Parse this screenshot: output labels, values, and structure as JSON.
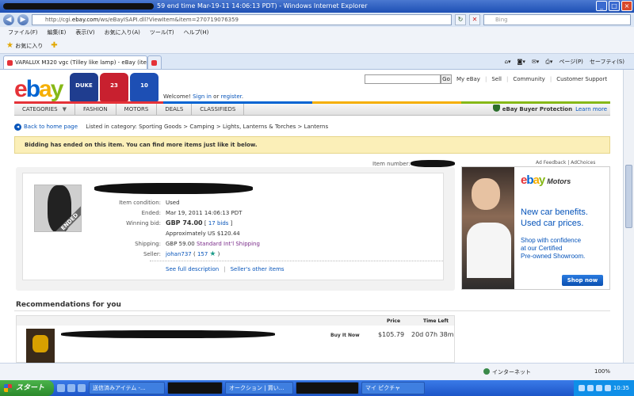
{
  "browser": {
    "title_suffix": "59 end time Mar-19-11 14:06:13 PDT) - Windows Internet Explorer",
    "url_prefix": "http://cgi.",
    "url_domain": "ebay.com",
    "url_path": "/ws/eBayISAPI.dll?ViewItem&item=270719076359",
    "search_placeholder": "Bing",
    "menu": [
      "ファイル(F)",
      "編集(E)",
      "表示(V)",
      "お気に入り(A)",
      "ツール(T)",
      "ヘルプ(H)"
    ],
    "favorites_label": "お気に入り",
    "tab_title": "VAPALUX M320 vgc (Tilley like lamp) - eBay (ite...",
    "tab_tools": [
      "ページ(P)",
      "セーフティ(S)"
    ],
    "status_zone": "インターネット",
    "zoom": "100%"
  },
  "header": {
    "welcome_prefix": "Welcome! ",
    "sign_in": "Sign in",
    "or": " or ",
    "register": "register",
    "welcome_suffix": ".",
    "go_label": "Go",
    "links": [
      "My eBay",
      "Sell",
      "Community",
      "Customer Support"
    ],
    "jerseys": [
      {
        "text": "DUKE",
        "color": "#1f3d8f"
      },
      {
        "text": "23",
        "color": "#c8202f"
      },
      {
        "text": "10",
        "color": "#1d4fb4"
      }
    ]
  },
  "nav": {
    "categories": "CATEGORIES",
    "items": [
      "FASHION",
      "MOTORS",
      "DEALS",
      "CLASSIFIEDS"
    ],
    "protection": "eBay Buyer Protection",
    "learn_more": "Learn more"
  },
  "breadcrumb": {
    "back": "Back to home page",
    "listed_in": "Listed in category:",
    "path": [
      "Sporting Goods",
      "Camping",
      "Lights, Lanterns & Torches",
      "Lanterns"
    ]
  },
  "banner": "Bidding has ended on this item. You can find more items just like it below.",
  "item": {
    "number_label": "Item number:",
    "ended_tag": "ENDED",
    "condition_label": "Item condition:",
    "condition": "Used",
    "ended_label": "Ended:",
    "ended": "Mar 19, 2011 14:06:13 PDT",
    "winning_label": "Winning bid:",
    "winning_bid": "GBP 74.00",
    "bids_open": "[ ",
    "bids": "17 bids",
    "bids_close": " ]",
    "approx": "Approximately US $120.44",
    "shipping_label": "Shipping:",
    "shipping_cost": "GBP 59.00",
    "shipping_method": "Standard Int'l Shipping",
    "seller_label": "Seller:",
    "seller": "johan737",
    "feedback_open": "( ",
    "feedback": "157",
    "feedback_close": " )",
    "see_full": "See full description",
    "other_items": "Seller's other items"
  },
  "ad": {
    "links": "Ad Feedback | AdChoices",
    "logo_e": "e",
    "logo_b": "b",
    "logo_a": "a",
    "logo_y": "y",
    "logo_suffix": "Motors",
    "headline1": "New car benefits.",
    "headline2": "Used car prices.",
    "body": [
      "Shop with confidence",
      "at our Certified",
      "Pre-owned Showroom."
    ],
    "cta": "Shop now"
  },
  "recommendations": {
    "heading": "Recommendations for you",
    "col_price": "Price",
    "col_time": "Time Left",
    "rows": [
      {
        "format": "Buy It Now",
        "price": "$105.79",
        "time_left": "20d 07h 38m"
      }
    ]
  },
  "taskbar": {
    "start": "スタート",
    "tasks": [
      "送信済みアイテム -...",
      "オークション | 買い...",
      "マイ ピクチャ"
    ],
    "clock": "10:35"
  }
}
